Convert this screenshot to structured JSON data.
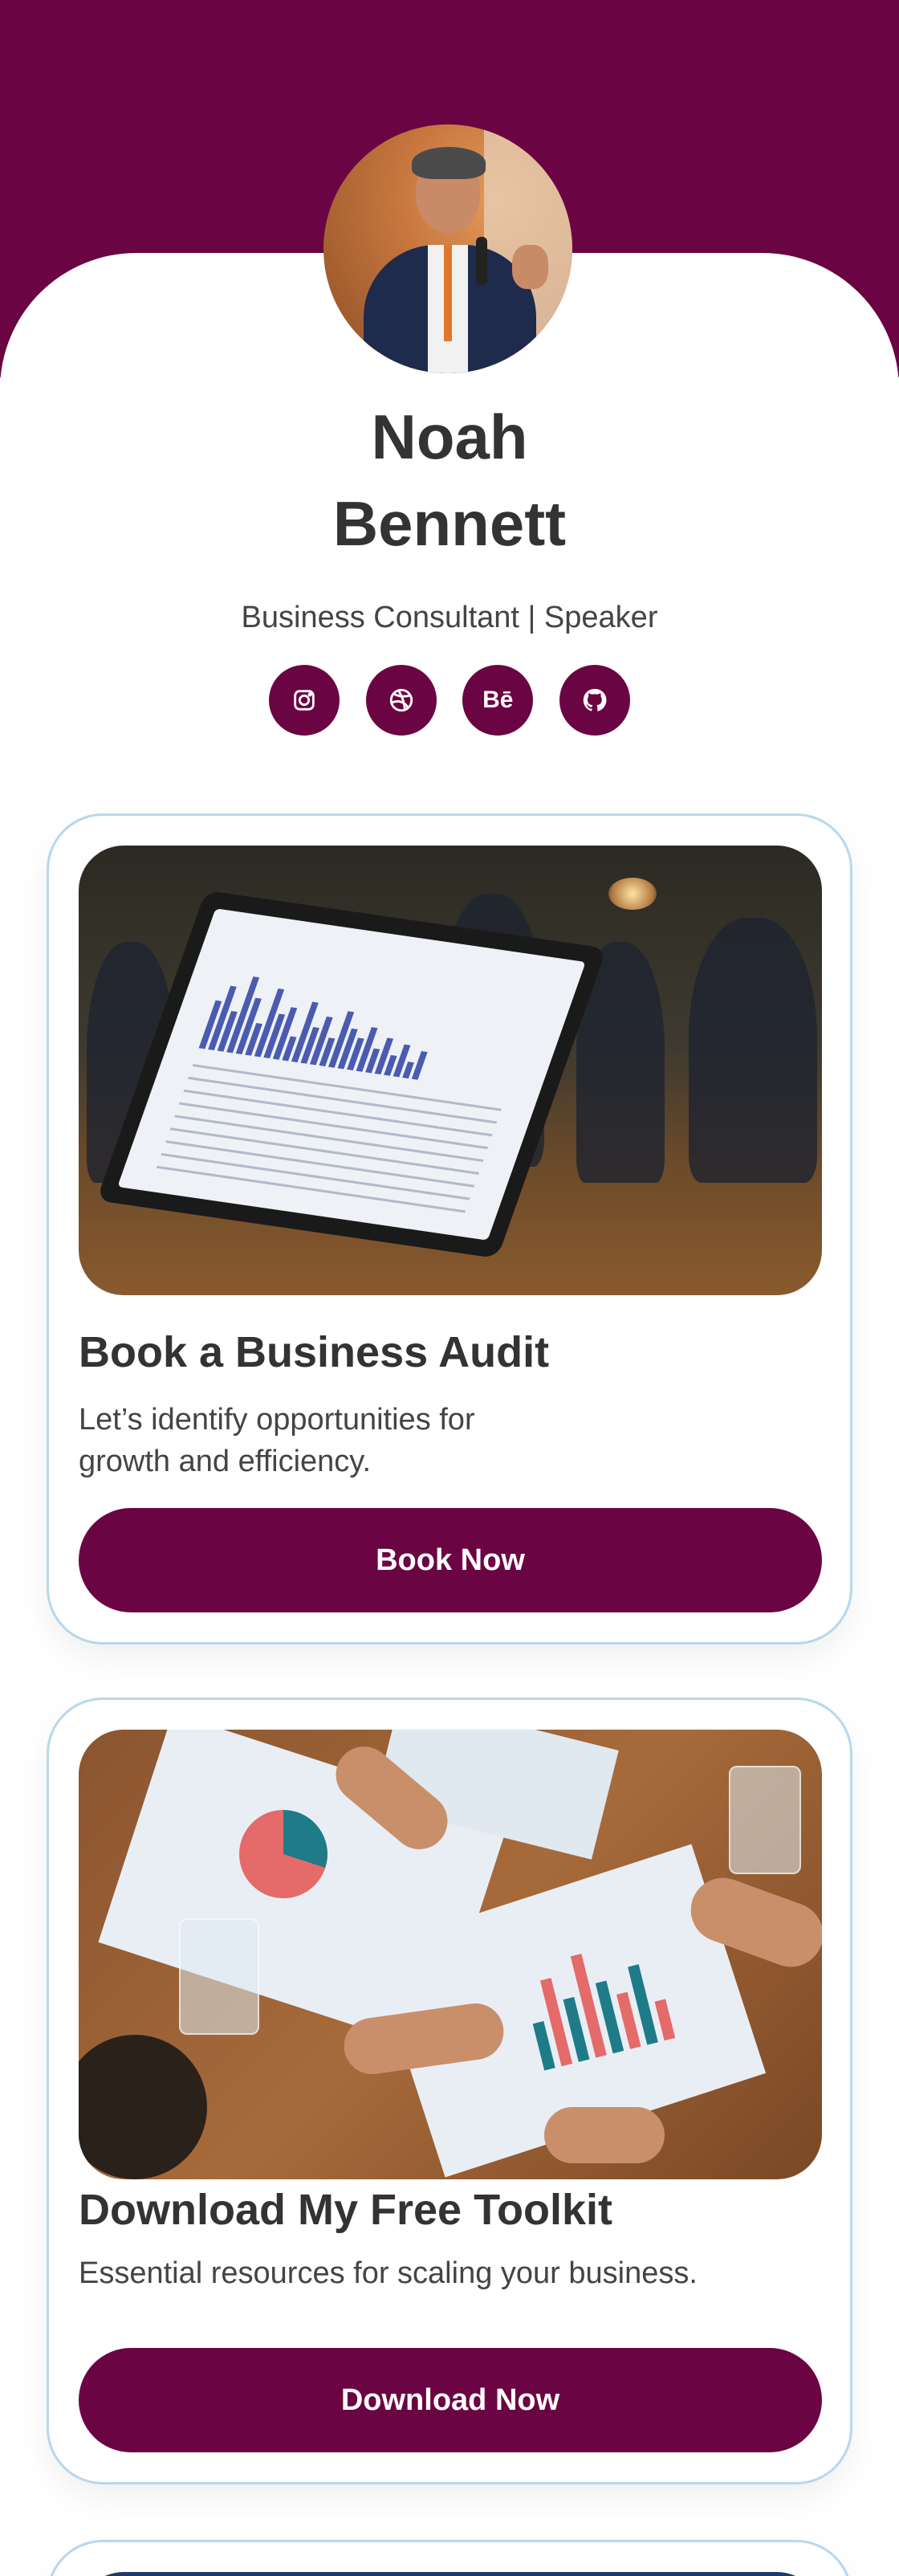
{
  "profile": {
    "first_name": "Noah",
    "last_name": "Bennett",
    "title": "Business Consultant | Speaker"
  },
  "socials": [
    {
      "name": "instagram",
      "icon": "instagram-icon"
    },
    {
      "name": "dribbble",
      "icon": "dribbble-icon"
    },
    {
      "name": "behance",
      "icon": "behance-icon",
      "glyph": "Bē"
    },
    {
      "name": "github",
      "icon": "github-icon"
    }
  ],
  "cards": [
    {
      "title": "Book a Business Audit",
      "description_line1": "Let’s identify opportunities for",
      "description_line2": "growth and efficiency.",
      "button": "Book Now"
    },
    {
      "title": "Download My Free Toolkit",
      "description": "Essential resources for scaling your business.",
      "button": "Download Now"
    }
  ],
  "colors": {
    "brand": "#6b0443",
    "card_border": "#b8d7ec",
    "text": "#333333"
  }
}
